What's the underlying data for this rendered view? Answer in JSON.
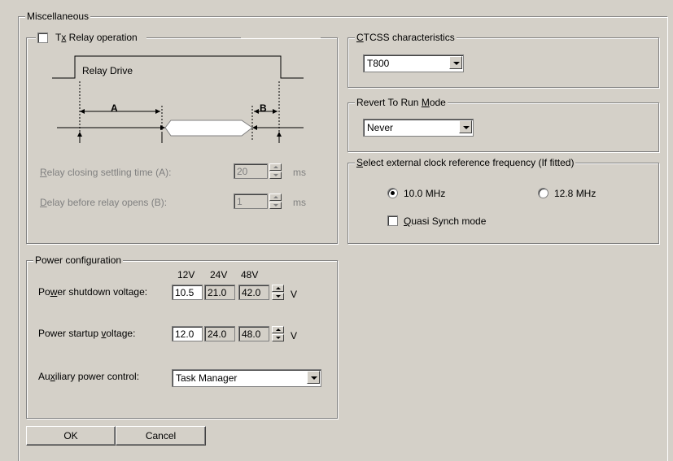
{
  "misc": {
    "title": "Miscellaneous",
    "tx_relay": {
      "checkbox_label_pre": "T",
      "checkbox_label_u": "x",
      "checkbox_label_post": " Relay operation",
      "checked": false,
      "diagram": {
        "title": "Relay Drive",
        "a_label": "A",
        "b_label": "B"
      },
      "closing_label_u": "R",
      "closing_label_rest": "elay closing settling time (A):",
      "closing_value": "20",
      "closing_unit": "ms",
      "opens_label_u": "D",
      "opens_label_rest": "elay before relay opens (B):",
      "opens_value": "1",
      "opens_unit": "ms"
    },
    "ctcss": {
      "title_u": "C",
      "title_rest": "TCSS characteristics",
      "value": "T800"
    },
    "revert": {
      "title_pre": "Revert To Run ",
      "title_u": "M",
      "title_post": "ode",
      "value": "Never"
    },
    "clock": {
      "title_u": "S",
      "title_rest": "elect external clock reference frequency (If fitted)",
      "opt1": "10.0 MHz",
      "opt2": "12.8 MHz",
      "selected": "10.0 MHz",
      "quasi_u": "Q",
      "quasi_rest": "uasi Synch mode",
      "quasi_checked": false
    },
    "power": {
      "title": "Power configuration",
      "col_12": "12V",
      "col_24": "24V",
      "col_48": "48V",
      "shutdown_pre": "Po",
      "shutdown_u": "w",
      "shutdown_post": "er shutdown voltage:",
      "shutdown_values": [
        "10.5",
        "21.0",
        "42.0"
      ],
      "startup_pre": "Power startup ",
      "startup_u": "v",
      "startup_post": "oltage:",
      "startup_values": [
        "12.0",
        "24.0",
        "48.0"
      ],
      "unit": "V",
      "aux_pre": "Au",
      "aux_u": "x",
      "aux_post": "iliary power control:",
      "aux_value": "Task Manager"
    },
    "buttons": {
      "ok": "OK",
      "cancel": "Cancel"
    }
  }
}
